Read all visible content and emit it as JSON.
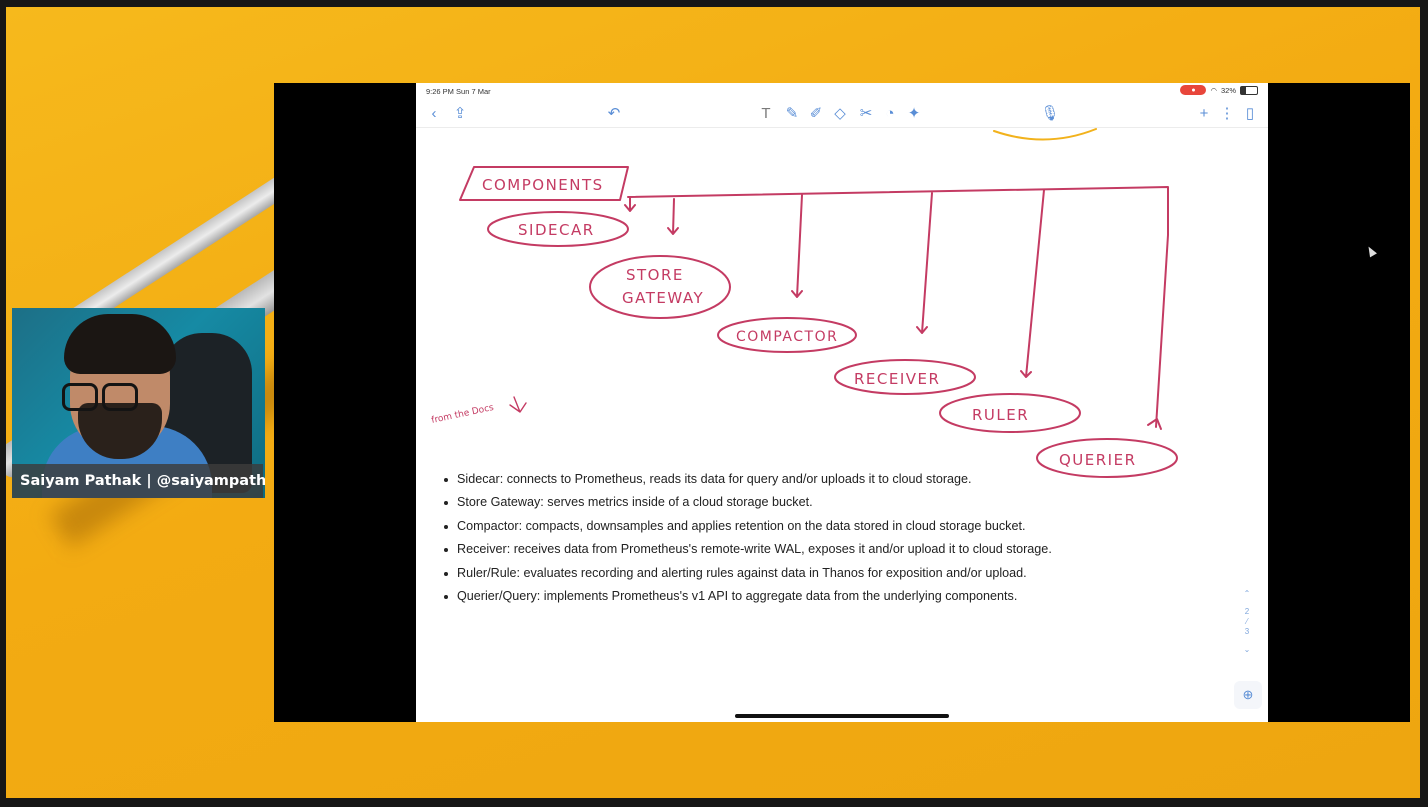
{
  "ipad": {
    "status_time": "9:26 PM  Sun 7 Mar",
    "battery": "32%",
    "toolbar_icons": [
      "back-icon",
      "share-icon",
      "undo-icon",
      "text-tool-icon",
      "pen-icon",
      "highlighter-icon",
      "eraser-icon",
      "lasso-icon",
      "shapes-icon",
      "laser-icon",
      "mic-icon",
      "add-page-icon",
      "more-icon",
      "pages-icon"
    ]
  },
  "diagram": {
    "title": "COMPONENTS",
    "nodes": {
      "sidecar": "SIDECAR",
      "store_line1": "STORE",
      "store_line2": "GATEWAY",
      "compactor": "COMPACTOR",
      "receiver": "RECEIVER",
      "ruler": "RULER",
      "querier": "QUERIER"
    },
    "annotation": "from the Docs",
    "ink_color": "#c43b63"
  },
  "bullets": [
    "Sidecar: connects to Prometheus, reads its data for query and/or uploads it to cloud storage.",
    "Store Gateway: serves metrics inside of a cloud storage bucket.",
    "Compactor: compacts, downsamples and applies retention on the data stored in cloud storage bucket.",
    "Receiver: receives data from Prometheus's remote-write WAL, exposes it and/or upload it to cloud storage.",
    "Ruler/Rule: evaluates recording and alerting rules against data in Thanos for exposition and/or upload.",
    "Querier/Query: implements Prometheus's v1 API to aggregate data from the underlying components."
  ],
  "pager": {
    "current": "2",
    "total": "3"
  },
  "webcam": {
    "name": "Saiyam Pathak | @saiyampathak"
  }
}
